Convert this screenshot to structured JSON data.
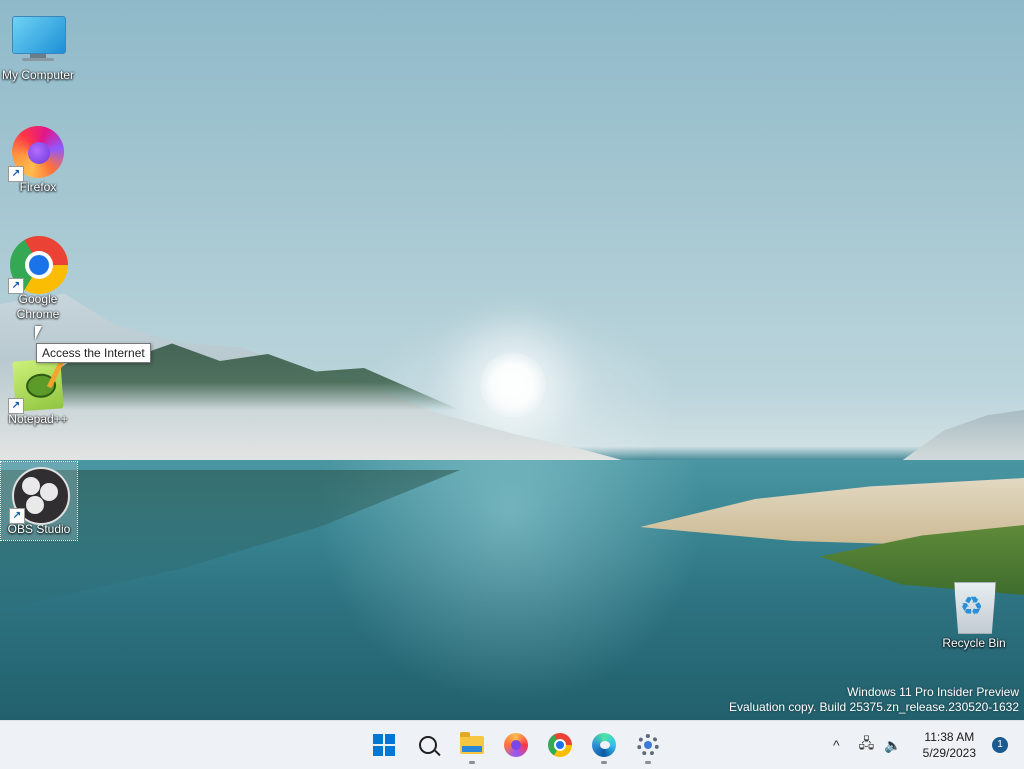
{
  "desktop": {
    "icons": [
      {
        "label": "My Computer"
      },
      {
        "label": "Firefox"
      },
      {
        "label": "Google Chrome"
      },
      {
        "label": "Notepad++"
      },
      {
        "label": "OBS Studio"
      },
      {
        "label": "Recycle Bin"
      }
    ],
    "tooltip": "Access the Internet",
    "watermark": {
      "line1": "Windows 11 Pro Insider Preview",
      "line2": "Evaluation copy. Build 25375.zn_release.230520-1632"
    }
  },
  "taskbar": {
    "pinned": [
      {
        "name": "start",
        "icon": "windows-logo-icon"
      },
      {
        "name": "search",
        "icon": "search-icon"
      },
      {
        "name": "file-explorer",
        "icon": "folder-icon"
      },
      {
        "name": "firefox",
        "icon": "firefox-icon"
      },
      {
        "name": "chrome",
        "icon": "chrome-icon"
      },
      {
        "name": "edge",
        "icon": "edge-icon"
      },
      {
        "name": "settings",
        "icon": "gear-icon"
      }
    ],
    "tray": {
      "chevron": "^",
      "time": "11:38 AM",
      "date": "5/29/2023",
      "notification_count": "1"
    }
  },
  "colors": {
    "accent": "#0078d4",
    "taskbar_bg": "#eef1f5"
  }
}
